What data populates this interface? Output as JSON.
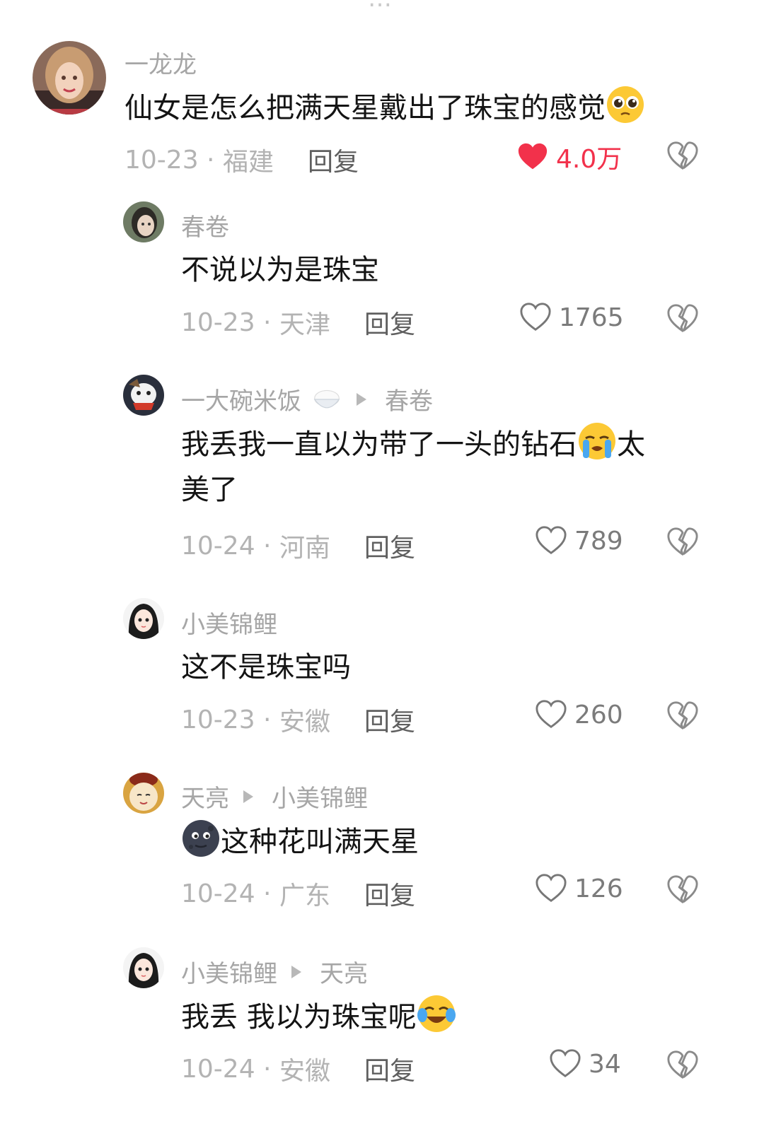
{
  "top_cut_text": "…",
  "comments": [
    {
      "author": "一龙龙",
      "text": "仙女是怎么把满天星戴出了珠宝的感觉",
      "emoji": "pleading-face",
      "date": "10-23",
      "location": "福建",
      "reply_label": "回复",
      "likes": "4.0万",
      "liked": true
    },
    {
      "author": "春卷",
      "text": "不说以为是珠宝",
      "date": "10-23",
      "location": "天津",
      "reply_label": "回复",
      "likes": "1765"
    },
    {
      "author": "一大碗米饭",
      "author_emoji": "rice-bowl",
      "reply_to": "春卷",
      "text_a": "我丢我一直以为带了一头的钻石",
      "emoji": "loudly-crying-face",
      "text_b": "太",
      "text_line2": "美了",
      "date": "10-24",
      "location": "河南",
      "reply_label": "回复",
      "likes": "789"
    },
    {
      "author": "小美锦鲤",
      "text": "这不是珠宝吗",
      "date": "10-23",
      "location": "安徽",
      "reply_label": "回复",
      "likes": "260"
    },
    {
      "author": "天亮",
      "reply_to": "小美锦鲤",
      "emoji": "new-moon-face",
      "text": "这种花叫满天星",
      "date": "10-24",
      "location": "广东",
      "reply_label": "回复",
      "likes": "126"
    },
    {
      "author": "小美锦鲤",
      "reply_to": "天亮",
      "text": "我丢 我以为珠宝呢",
      "emoji": "tears-of-joy-face",
      "date": "10-24",
      "location": "安徽",
      "reply_label": "回复",
      "likes": "34"
    }
  ],
  "colors": {
    "liked": "#f2314b",
    "meta": "#b3b3b3",
    "name": "#a6a6a6"
  },
  "icons": {
    "like": "heart-outline-icon",
    "liked": "heart-filled-icon",
    "dislike": "broken-heart-icon"
  }
}
